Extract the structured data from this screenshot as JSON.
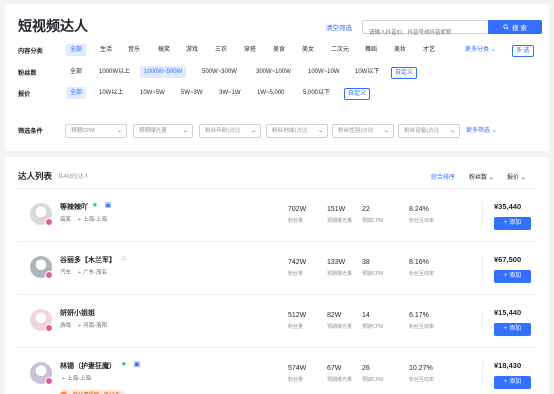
{
  "header": {
    "title": "短视频达人",
    "clear_filter": "清空筛选",
    "search_placeholder": "请输入抖音ID、抖音号或抖音昵称",
    "search_button": "搜 索"
  },
  "filters": {
    "content_category": {
      "label": "内容分类",
      "options": [
        "全部",
        "生活",
        "音乐",
        "搞笑",
        "游戏",
        "三农",
        "穿搭",
        "美食",
        "美女",
        "二次元",
        "舞蹈",
        "美妆",
        "才艺"
      ],
      "selected": "全部",
      "more": "更多分类",
      "multi": "多 选"
    },
    "fan_count": {
      "label": "粉丝数",
      "options": [
        "全部",
        "1000W以上",
        "1000W~500W",
        "500W~300W",
        "300W~100W",
        "100W~10W",
        "10W以下"
      ],
      "selected": "1000W~500W",
      "custom": "自定义"
    },
    "quote": {
      "label": "报价",
      "options": [
        "全部",
        "10W以上",
        "10W~5W",
        "5W~3W",
        "3W~1W",
        "1W~5,000",
        "5,000以下"
      ],
      "selected": "全部",
      "custom": "自定义"
    },
    "conditions": {
      "label": "筛选条件",
      "selects": [
        "预期CPM",
        "预期曝光量",
        "粉丝年龄(占比",
        "粉丝地域(占比",
        "粉丝性别(占比",
        "粉丝设备(占比"
      ],
      "more": "更多筛选"
    }
  },
  "list": {
    "title": "达人列表",
    "count": "共468位达人",
    "sort_options": [
      "综合排序",
      "粉丝数",
      "报价"
    ],
    "active_sort": "综合排序",
    "metric_labels": [
      "粉丝量",
      "预期曝光量",
      "预期CPM",
      "粉丝互动率"
    ],
    "add_label": "+ 添加",
    "items": [
      {
        "name": "等辣辣吖",
        "category": "搞笑",
        "location": "上海-上海",
        "fans": "702W",
        "exposure": "151W",
        "cpm": "22",
        "interaction": "8.24%",
        "price": "¥35,440",
        "avatar_color": "#d9d9d9",
        "has_crown": true,
        "has_case": true,
        "has_fire": false
      },
      {
        "name": "谷丽多【木兰军】",
        "category": "汽车",
        "location": "广东-茂名",
        "fans": "742W",
        "exposure": "133W",
        "cpm": "38",
        "interaction": "8.16%",
        "price": "¥67,500",
        "avatar_color": "#b0b5bb",
        "has_crown": false,
        "has_case": false,
        "has_fire": true
      },
      {
        "name": "妍妍小姐姐",
        "category": "游戏",
        "location": "河南-洛阳",
        "fans": "512W",
        "exposure": "82W",
        "cpm": "14",
        "interaction": "6.17%",
        "price": "¥15,440",
        "avatar_color": "#f3d3dc",
        "has_crown": false,
        "has_case": false,
        "has_fire": false
      },
      {
        "name": "林锡（护妻狂魔）",
        "category": "",
        "location": "上海-上海",
        "fans": "574W",
        "exposure": "67W",
        "cpm": "26",
        "interaction": "10.27%",
        "price": "¥18,430",
        "avatar_color": "#c9c1d6",
        "has_crown": true,
        "has_case": true,
        "has_fire": false,
        "promo": "韩化表现榜 · 第14名"
      }
    ]
  },
  "colors": {
    "accent": "#3370ff",
    "selected_bg": "#e1eaff",
    "badge": "#e35ba0"
  }
}
